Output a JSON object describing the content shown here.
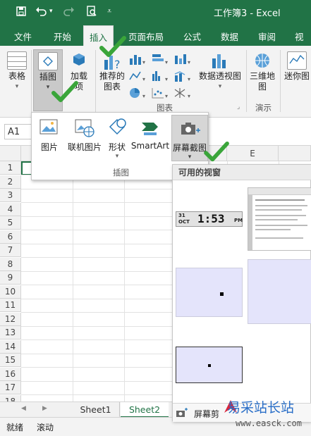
{
  "window": {
    "title": "工作簿3 - Excel"
  },
  "ribbon_tabs": [
    "文件",
    "开始",
    "插入",
    "页面布局",
    "公式",
    "数据",
    "审阅",
    "视图"
  ],
  "ribbon": {
    "table": "表格",
    "illustrations": "插图",
    "addins_line1": "加载",
    "addins_line2": "项",
    "recommended_line1": "推荐的",
    "recommended_line2": "图表",
    "pivotchart": "数据透视图",
    "map3d_line1": "三维地",
    "map3d_line2": "图",
    "sparklines": "迷你图",
    "group_charts": "图表",
    "group_tours": "演示"
  },
  "formula_bar": {
    "name_box": "A1"
  },
  "illustrations_menu": {
    "picture": "图片",
    "online_picture": "联机图片",
    "shapes": "形状",
    "smartart": "SmartArt",
    "screenshot": "屏幕截图",
    "group_label": "插图"
  },
  "screenshot_menu": {
    "header": "可用的视窗",
    "clock_date_line1": "31",
    "clock_date_line2": "OCT",
    "clock_time": "1:53",
    "clock_ampm": "PM",
    "clipping": "屏幕剪"
  },
  "grid": {
    "columns": [
      "E"
    ],
    "rows": [
      "1",
      "2",
      "3",
      "4",
      "5",
      "6",
      "7",
      "8",
      "9",
      "10",
      "11",
      "12",
      "13",
      "14",
      "15",
      "16",
      "17",
      "18"
    ]
  },
  "sheets": [
    "Sheet1",
    "Sheet2"
  ],
  "status": {
    "ready": "就绪",
    "scroll": "滚动"
  },
  "watermark": {
    "text": "易采站长站",
    "url": "www.easck.com"
  },
  "colors": {
    "excel_green": "#217346",
    "check_green": "#3aa53a"
  }
}
